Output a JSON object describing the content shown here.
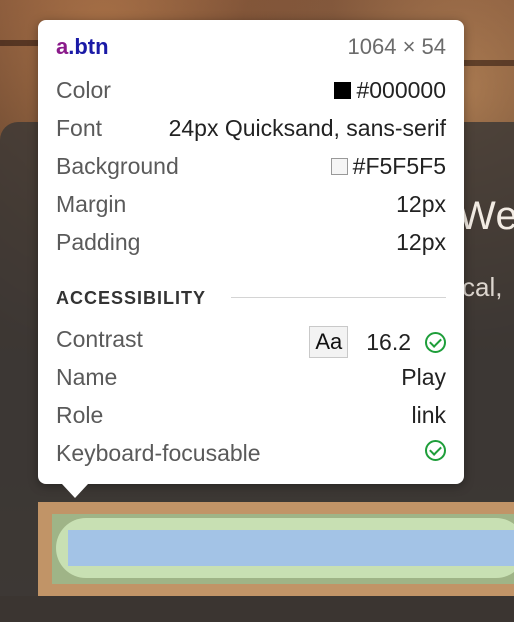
{
  "background_page": {
    "heading_fragment": "Wel",
    "text_fragment": "cal,"
  },
  "tooltip": {
    "selector_tag": "a",
    "selector_class": ".btn",
    "dimensions": "1064 × 54",
    "properties": [
      {
        "label": "Color",
        "value": "#000000",
        "swatch": "#000000"
      },
      {
        "label": "Font",
        "value": "24px Quicksand, sans-serif"
      },
      {
        "label": "Background",
        "value": "#F5F5F5",
        "swatch": "#F5F5F5"
      },
      {
        "label": "Margin",
        "value": "12px"
      },
      {
        "label": "Padding",
        "value": "12px"
      }
    ],
    "accessibility": {
      "title": "ACCESSIBILITY",
      "contrast": {
        "label": "Contrast",
        "sample": "Aa",
        "value": "16.2",
        "status_icon": "check-circle-icon"
      },
      "name": {
        "label": "Name",
        "value": "Play"
      },
      "role": {
        "label": "Role",
        "value": "link"
      },
      "keyboard": {
        "label": "Keyboard-focusable",
        "status_icon": "check-circle-icon"
      }
    }
  },
  "colors": {
    "pass_green": "#1e9e3a",
    "margin_highlight": "#c19467",
    "padding_highlight": "#9fb487",
    "content_highlight": "#a3c3e6"
  }
}
